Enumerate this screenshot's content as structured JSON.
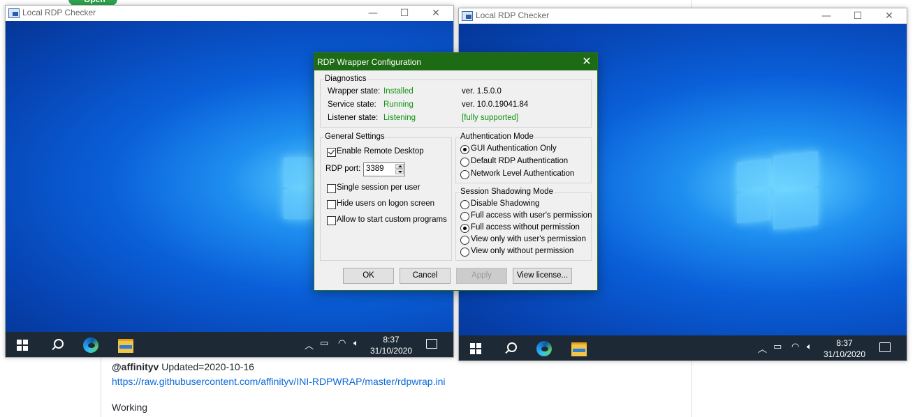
{
  "background": {
    "badge": "Open",
    "comment": {
      "author": "@affinityv",
      "updated": "Updated=2020-10-16",
      "link": "https://raw.githubusercontent.com/affinityv/INI-RDPWRAP/master/rdpwrap.ini",
      "body": "Working"
    }
  },
  "windows": [
    {
      "title": "Local RDP Checker",
      "time": "8:37",
      "date": "31/10/2020"
    },
    {
      "title": "Local RDP Checker",
      "time": "8:37",
      "date": "31/10/2020"
    }
  ],
  "window_controls": {
    "minimize": "—",
    "maximize": "☐",
    "close": "✕"
  },
  "dialog": {
    "title": "RDP Wrapper Configuration",
    "close": "✕",
    "diagnostics": {
      "title": "Diagnostics",
      "wrapper_label": "Wrapper state:",
      "wrapper_value": "Installed",
      "wrapper_version": "ver. 1.5.0.0",
      "service_label": "Service state:",
      "service_value": "Running",
      "service_version": "ver. 10.0.19041.84",
      "listener_label": "Listener state:",
      "listener_value": "Listening",
      "listener_support": "[fully supported]"
    },
    "general": {
      "title": "General Settings",
      "enable_rd": "Enable Remote Desktop",
      "enable_rd_checked": true,
      "rdp_port_label": "RDP port:",
      "rdp_port_value": "3389",
      "single_session": "Single session per user",
      "hide_users": "Hide users on logon screen",
      "allow_custom": "Allow to start custom programs"
    },
    "auth": {
      "title": "Authentication Mode",
      "options": [
        "GUI Authentication Only",
        "Default RDP Authentication",
        "Network Level Authentication"
      ],
      "selected": 0
    },
    "shadow": {
      "title": "Session Shadowing Mode",
      "options": [
        "Disable Shadowing",
        "Full access with user's permission",
        "Full access without permission",
        "View only with user's permission",
        "View only without permission"
      ],
      "selected": 2
    },
    "buttons": {
      "ok": "OK",
      "cancel": "Cancel",
      "apply": "Apply",
      "license": "View license..."
    }
  },
  "colors": {
    "dialog_title_bg": "#1e6b16",
    "status_green": "#119211",
    "taskbar": "#1d2a35",
    "link": "#0969da"
  }
}
